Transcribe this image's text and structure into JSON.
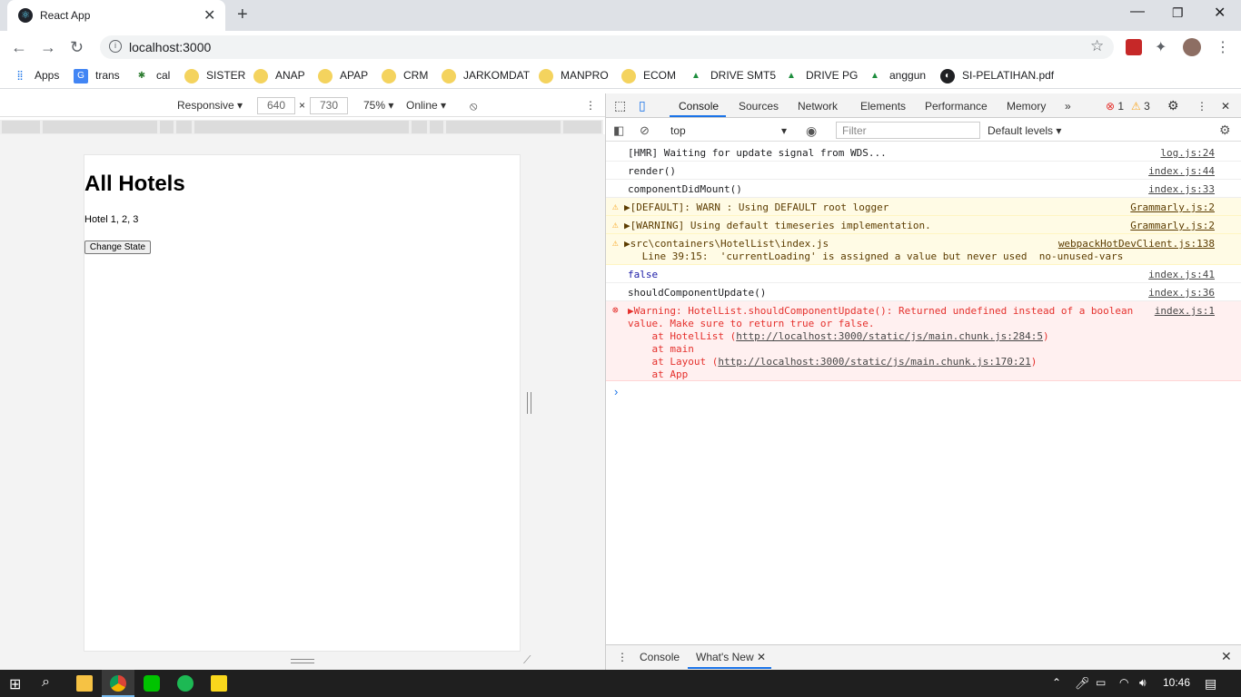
{
  "browser": {
    "tab_title": "React App",
    "url": "localhost:3000"
  },
  "bookmarks": [
    {
      "label": "Apps"
    },
    {
      "label": "trans"
    },
    {
      "label": "cal"
    },
    {
      "label": "SISTER"
    },
    {
      "label": "ANAP"
    },
    {
      "label": "APAP"
    },
    {
      "label": "CRM"
    },
    {
      "label": "JARKOMDAT"
    },
    {
      "label": "MANPRO"
    },
    {
      "label": "ECOM"
    },
    {
      "label": "DRIVE SMT5"
    },
    {
      "label": "DRIVE PG"
    },
    {
      "label": "anggun"
    },
    {
      "label": "SI-PELATIHAN.pdf"
    }
  ],
  "device_toolbar": {
    "device": "Responsive",
    "width": "640",
    "height": "730",
    "zoom": "75%",
    "throttle": "Online"
  },
  "app": {
    "heading": "All Hotels",
    "text": "Hotel 1, 2, 3",
    "button": "Change State"
  },
  "devtools": {
    "tabs": [
      "Console",
      "Sources",
      "Network",
      "Elements",
      "Performance",
      "Memory"
    ],
    "errors": "1",
    "warnings": "3",
    "context": "top",
    "filter_placeholder": "Filter",
    "levels": "Default levels",
    "logs": [
      {
        "type": "log",
        "msg": "[HMR] Waiting for update signal from WDS...",
        "src": "log.js:24"
      },
      {
        "type": "log",
        "msg": "render()",
        "src": "index.js:44"
      },
      {
        "type": "log",
        "msg": "componentDidMount()",
        "src": "index.js:33"
      },
      {
        "type": "warn",
        "msg": "▶[DEFAULT]: WARN : Using DEFAULT root logger",
        "src": "Grammarly.js:2"
      },
      {
        "type": "warn",
        "msg": "▶[WARNING] Using default timeseries implementation.",
        "src": "Grammarly.js:2"
      },
      {
        "type": "warn",
        "msg": "▶src\\containers\\HotelList\\index.js",
        "msg2": " Line 39:15:  'currentLoading' is assigned a value but never used  no-unused-vars",
        "src": "webpackHotDevClient.js:138"
      },
      {
        "type": "log",
        "msg": "false",
        "src": "index.js:41"
      },
      {
        "type": "log",
        "msg": "shouldComponentUpdate()",
        "src": "index.js:36"
      },
      {
        "type": "error",
        "msg": "▶Warning: HotelList.shouldComponentUpdate(): Returned undefined instead of a boolean",
        "msg2": "value. Make sure to return true or false.",
        "l3a": "    at HotelList (",
        "l3link": "http://localhost:3000/static/js/main.chunk.js:284:5",
        "l3b": ")",
        "l4": "    at main",
        "l5a": "    at Layout (",
        "l5link": "http://localhost:3000/static/js/main.chunk.js:170:21",
        "l5b": ")",
        "l6": "    at App",
        "src": "index.js:1"
      }
    ],
    "drawer_tabs": [
      "Console",
      "What's New"
    ]
  },
  "taskbar": {
    "time": "10:46"
  }
}
